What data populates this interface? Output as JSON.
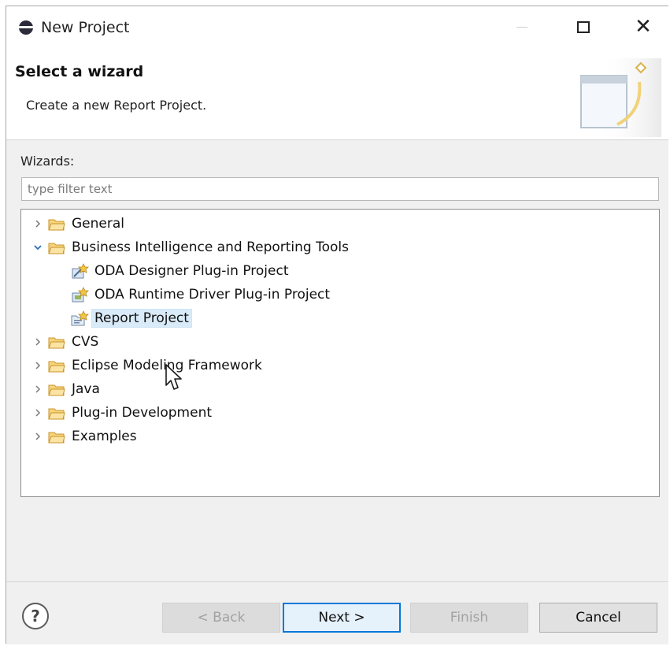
{
  "window": {
    "title": "New Project"
  },
  "banner": {
    "title": "Select a wizard",
    "description": "Create a new Report Project."
  },
  "wizards": {
    "label": "Wizards:",
    "filter_placeholder": "type filter text",
    "filter_value": ""
  },
  "tree": {
    "items": [
      {
        "label": "General",
        "expanded": false,
        "level": 0,
        "icon": "folder-icon"
      },
      {
        "label": "Business Intelligence and Reporting Tools",
        "expanded": true,
        "level": 0,
        "icon": "folder-icon"
      },
      {
        "label": "ODA Designer Plug-in Project",
        "level": 1,
        "icon": "oda-designer-project-icon"
      },
      {
        "label": "ODA Runtime Driver Plug-in Project",
        "level": 1,
        "icon": "oda-runtime-project-icon"
      },
      {
        "label": "Report Project",
        "level": 1,
        "icon": "report-project-icon",
        "selected": true
      },
      {
        "label": "CVS",
        "expanded": false,
        "level": 0,
        "icon": "folder-icon"
      },
      {
        "label": "Eclipse Modeling Framework",
        "expanded": false,
        "level": 0,
        "icon": "folder-icon"
      },
      {
        "label": "Java",
        "expanded": false,
        "level": 0,
        "icon": "folder-icon"
      },
      {
        "label": "Plug-in Development",
        "expanded": false,
        "level": 0,
        "icon": "folder-icon"
      },
      {
        "label": "Examples",
        "expanded": false,
        "level": 0,
        "icon": "folder-icon"
      }
    ]
  },
  "buttons": {
    "help": "?",
    "back": "< Back",
    "next": "Next >",
    "finish": "Finish",
    "cancel": "Cancel"
  },
  "colors": {
    "selection": "#d9ebf9",
    "default_button_border": "#0078d7",
    "folder": "#e7b84a"
  }
}
